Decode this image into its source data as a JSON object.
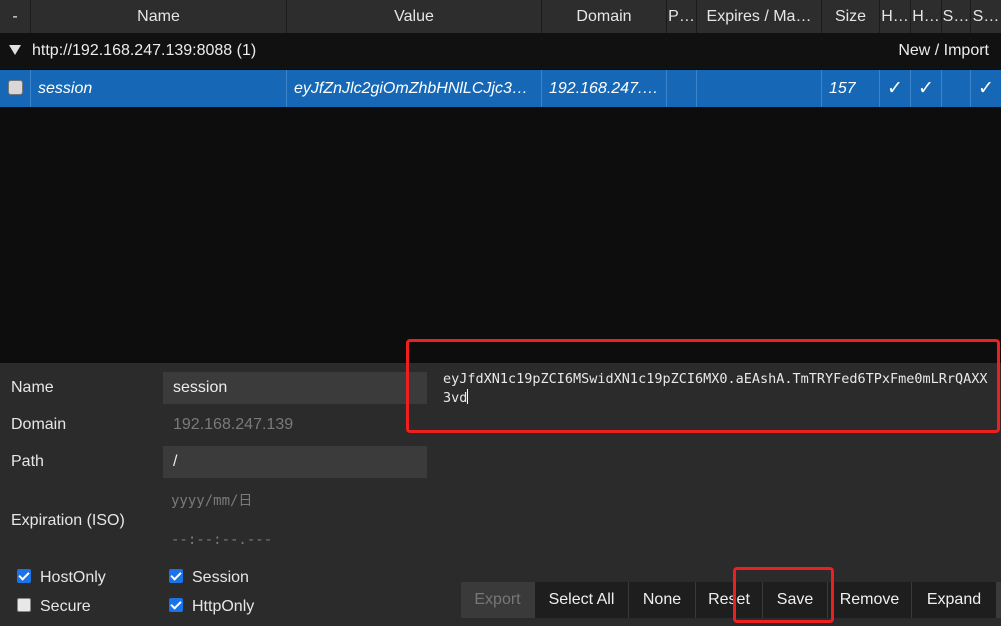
{
  "columns": {
    "select": "-",
    "name": "Name",
    "value": "Value",
    "domain": "Domain",
    "path": "P…",
    "expires": "Expires / Ma…",
    "size": "Size",
    "hostonly": "H…",
    "httponly": "H…",
    "secure": "S…",
    "session": "S…"
  },
  "group": {
    "label": "http://192.168.247.139:8088 (1)",
    "new_import": "New / Import"
  },
  "cookie": {
    "name": "session",
    "value": "eyJfZnJlc2giOmZhbHNlLCJjc3…",
    "domain": "192.168.247.…",
    "path": "",
    "expires": "",
    "size": "157",
    "hostonly_mark": "✓",
    "httponly_mark": "✓",
    "secure_mark": "",
    "session_mark": "✓"
  },
  "editor": {
    "name_label": "Name",
    "name_value": "session",
    "domain_label": "Domain",
    "domain_placeholder": "192.168.247.139",
    "path_label": "Path",
    "path_value": "/",
    "expiration_label": "Expiration (ISO)",
    "date_placeholder": "yyyy/mm/日",
    "time_placeholder": "--:--:--.---",
    "hostonly_label": "HostOnly",
    "hostonly_checked": true,
    "session_label": "Session",
    "session_checked": true,
    "secure_label": "Secure",
    "secure_checked": false,
    "httponly_label": "HttpOnly",
    "httponly_checked": true,
    "value_text": "eyJfdXN1c19pZCI6MSwidXN1c19pZCI6MX0.aEAshA.TmTRYFed6TPxFme0mLRrQAXX3vd"
  },
  "toolbar": {
    "export": "Export",
    "select_all": "Select All",
    "none": "None",
    "reset": "Reset",
    "save": "Save",
    "remove": "Remove",
    "expand": "Expand"
  },
  "colors": {
    "selected_row": "#1668b7",
    "highlight": "#ee1f1f",
    "checkbox_on": "#1a73e8"
  }
}
